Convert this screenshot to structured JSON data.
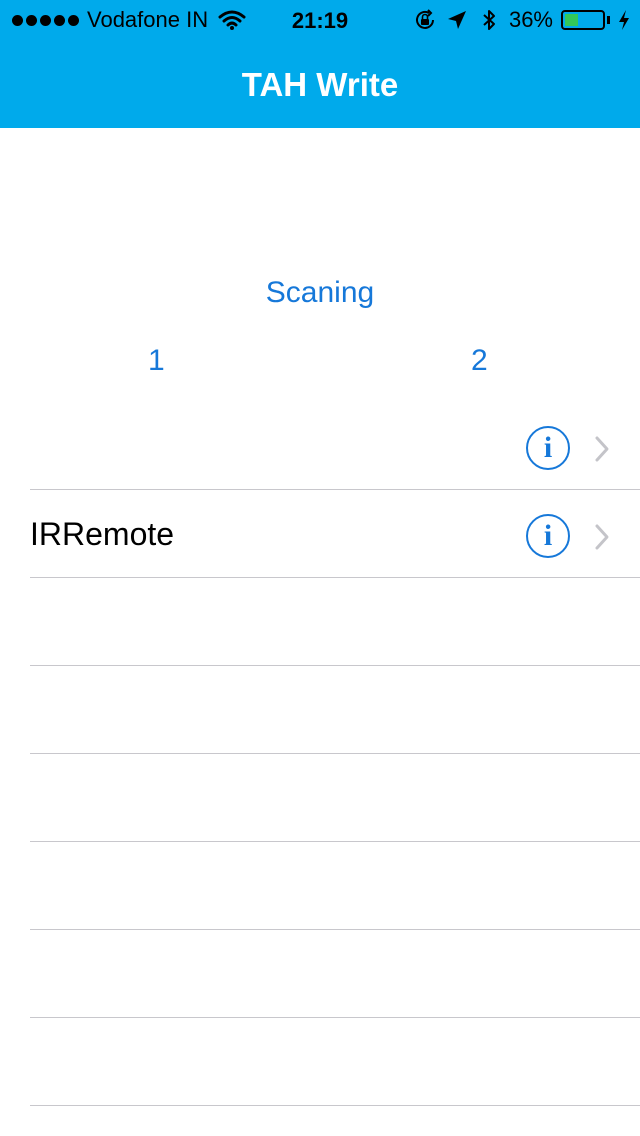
{
  "status_bar": {
    "carrier": "Vodafone IN",
    "time": "21:19",
    "battery_percent": "36%",
    "battery_level": 0.36,
    "signal_dots": 5,
    "icons": [
      "signal-dots-icon",
      "wifi-icon",
      "rotation-lock-icon",
      "location-arrow-icon",
      "bluetooth-icon",
      "battery-icon",
      "charging-bolt-icon"
    ]
  },
  "nav": {
    "title": "TAH Write",
    "bar_color": "#00aaeb"
  },
  "main": {
    "status_text": "Scaning",
    "column_1_label": "1",
    "column_2_label": "2",
    "accent_color": "#1678d9"
  },
  "devices": [
    {
      "label": "",
      "has_info": true,
      "has_chevron": true
    },
    {
      "label": "IRRemote",
      "has_info": true,
      "has_chevron": true
    },
    {
      "label": "",
      "has_info": false,
      "has_chevron": false
    },
    {
      "label": "",
      "has_info": false,
      "has_chevron": false
    },
    {
      "label": "",
      "has_info": false,
      "has_chevron": false
    },
    {
      "label": "",
      "has_info": false,
      "has_chevron": false
    },
    {
      "label": "",
      "has_info": false,
      "has_chevron": false
    },
    {
      "label": "",
      "has_info": false,
      "has_chevron": false
    }
  ],
  "info_glyph": "i"
}
